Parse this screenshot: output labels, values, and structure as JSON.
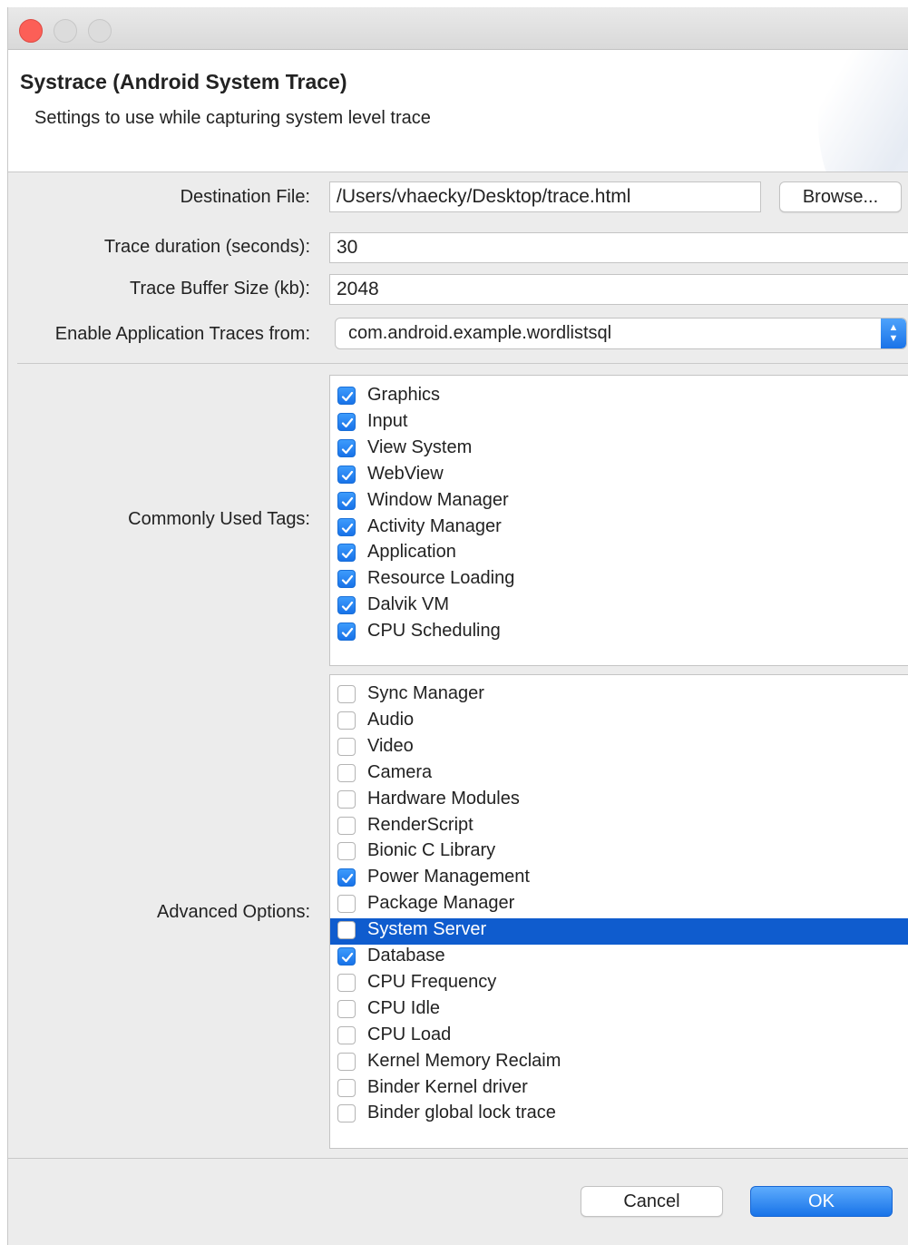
{
  "window": {
    "title": "Systrace (Android System Trace)",
    "subtitle": "Settings to use while capturing system level trace"
  },
  "destination": {
    "label": "Destination File:",
    "value": "/Users/vhaecky/Desktop/trace.html",
    "browse_label": "Browse..."
  },
  "duration": {
    "label": "Trace duration (seconds):",
    "value": "30"
  },
  "buffer": {
    "label": "Trace Buffer Size (kb):",
    "value": "2048"
  },
  "app_traces": {
    "label": "Enable Application Traces from:",
    "selected": "com.android.example.wordlistsql"
  },
  "common_tags": {
    "label": "Commonly Used Tags:",
    "items": [
      {
        "label": "Graphics",
        "checked": true
      },
      {
        "label": "Input",
        "checked": true
      },
      {
        "label": "View System",
        "checked": true
      },
      {
        "label": "WebView",
        "checked": true
      },
      {
        "label": "Window Manager",
        "checked": true
      },
      {
        "label": "Activity Manager",
        "checked": true
      },
      {
        "label": "Application",
        "checked": true
      },
      {
        "label": "Resource Loading",
        "checked": true
      },
      {
        "label": "Dalvik VM",
        "checked": true
      },
      {
        "label": "CPU Scheduling",
        "checked": true
      }
    ]
  },
  "advanced": {
    "label": "Advanced Options:",
    "items": [
      {
        "label": "Sync Manager",
        "checked": false
      },
      {
        "label": "Audio",
        "checked": false
      },
      {
        "label": "Video",
        "checked": false
      },
      {
        "label": "Camera",
        "checked": false
      },
      {
        "label": "Hardware Modules",
        "checked": false
      },
      {
        "label": "RenderScript",
        "checked": false
      },
      {
        "label": "Bionic C Library",
        "checked": false
      },
      {
        "label": "Power Management",
        "checked": true
      },
      {
        "label": "Package Manager",
        "checked": false
      },
      {
        "label": "System Server",
        "checked": false,
        "selected": true
      },
      {
        "label": "Database",
        "checked": true
      },
      {
        "label": "CPU Frequency",
        "checked": false
      },
      {
        "label": "CPU Idle",
        "checked": false
      },
      {
        "label": "CPU Load",
        "checked": false
      },
      {
        "label": "Kernel Memory Reclaim",
        "checked": false
      },
      {
        "label": "Binder Kernel driver",
        "checked": false
      },
      {
        "label": "Binder global lock trace",
        "checked": false
      }
    ]
  },
  "footer": {
    "cancel_label": "Cancel",
    "ok_label": "OK"
  }
}
